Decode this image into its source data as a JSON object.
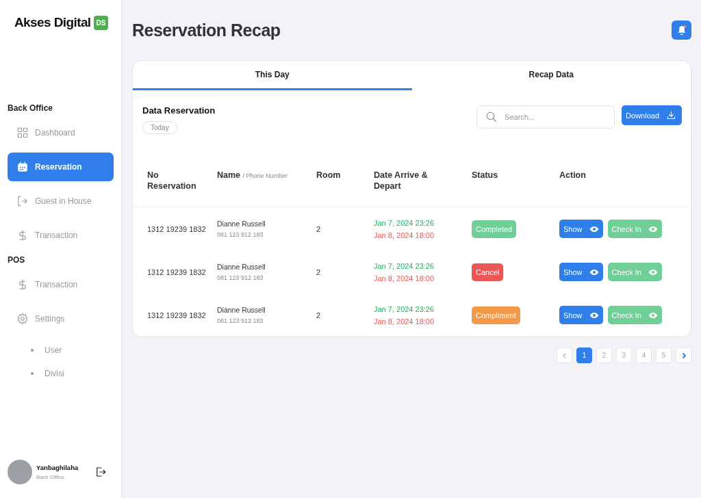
{
  "sidebar": {
    "brand": "Akses Digital",
    "brand_badge": "DS",
    "sections": [
      {
        "title": "Back Office",
        "items": [
          {
            "label": "Dashboard",
            "kind": "grid",
            "selected": false
          },
          {
            "label": "Reservation",
            "kind": "calendar",
            "selected": true
          },
          {
            "label": "Guest in House",
            "kind": "enter",
            "selected": false
          },
          {
            "label": "Transaction",
            "kind": "dollar",
            "selected": false
          }
        ]
      },
      {
        "title": "POS",
        "items": [
          {
            "label": "Transaction",
            "kind": "dollar",
            "selected": false
          },
          {
            "label": "Settings",
            "kind": "gear",
            "selected": false,
            "children": [
              {
                "label": "User"
              },
              {
                "label": "Divisi"
              }
            ]
          }
        ]
      }
    ],
    "user": {
      "name": "Yanbaghilaha",
      "role": "Back Office"
    }
  },
  "page_title": "Reservation Recap",
  "tabs": [
    {
      "label": "This Day",
      "selected": true
    },
    {
      "label": "Recap Data",
      "selected": false
    }
  ],
  "section_title": "Data Reservation",
  "filter_chip": "Today",
  "search": {
    "placeholder": "Search..."
  },
  "download_button": "Download",
  "table": {
    "columns": [
      {
        "label": "No Reservation"
      },
      {
        "label": "Name",
        "sub": "/ Phone Number"
      },
      {
        "label": "Room"
      },
      {
        "label": "Date Arrive & Depart"
      },
      {
        "label": "Status"
      },
      {
        "label": "Action"
      }
    ],
    "rows": [
      {
        "no": "1312 19239 1832",
        "name": "Dianne Russell",
        "phone": "081 123 912 183",
        "room": "2",
        "arrive": "Jan 7, 2024 23:26",
        "depart": "Jan 8, 2024 18:00",
        "status": {
          "label": "Completed",
          "color": "#6fcf97"
        },
        "actions": [
          "Show",
          "Check In"
        ]
      },
      {
        "no": "1312 19239 1832",
        "name": "Dianne Russell",
        "phone": "081 123 912 183",
        "room": "2",
        "arrive": "Jan 7, 2024 23:26",
        "depart": "Jan 8, 2024 18:00",
        "status": {
          "label": "Cancel",
          "color": "#eb5757"
        },
        "actions": [
          "Show",
          "Check In"
        ]
      },
      {
        "no": "1312 19239 1832",
        "name": "Dianne Russell",
        "phone": "081 123 912 183",
        "room": "2",
        "arrive": "Jan 7, 2024 23:26",
        "depart": "Jan 8, 2024 18:00",
        "status": {
          "label": "Compliment",
          "color": "#f2994a"
        },
        "actions": [
          "Show",
          "Check In"
        ]
      }
    ]
  },
  "pagination": {
    "prev_disabled": true,
    "next_disabled": false,
    "pages": [
      {
        "label": "1",
        "selected": true
      },
      {
        "label": "2",
        "selected": false
      },
      {
        "label": "3",
        "selected": false
      },
      {
        "label": "4",
        "selected": false
      },
      {
        "label": "5",
        "selected": false
      }
    ]
  }
}
